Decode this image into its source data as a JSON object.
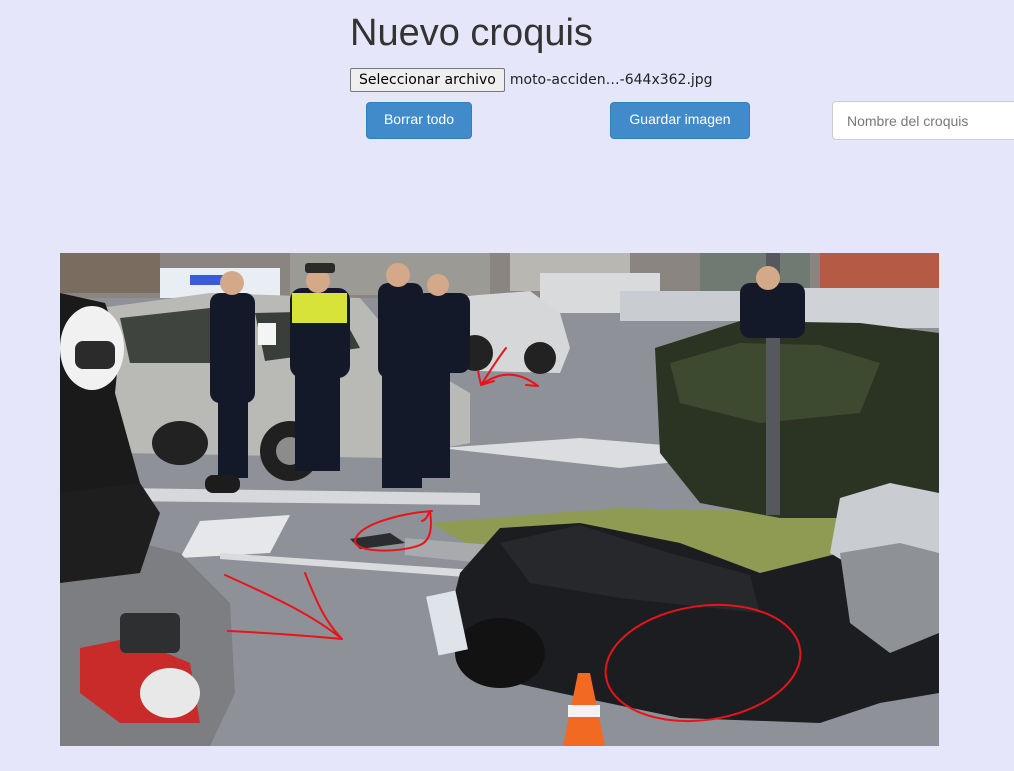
{
  "page": {
    "title": "Nuevo croquis"
  },
  "file_input": {
    "button_label": "Seleccionar archivo",
    "file_name": "moto-acciden…-644x362.jpg"
  },
  "toolbar": {
    "clear_label": "Borrar todo",
    "save_label": "Guardar imagen"
  },
  "name_field": {
    "placeholder": "Nombre del croquis",
    "value": ""
  },
  "sketch": {
    "background_photo": "motorcycle-accident-photo",
    "annotation_color": "#e8141a",
    "accent_color": "#428bca"
  }
}
